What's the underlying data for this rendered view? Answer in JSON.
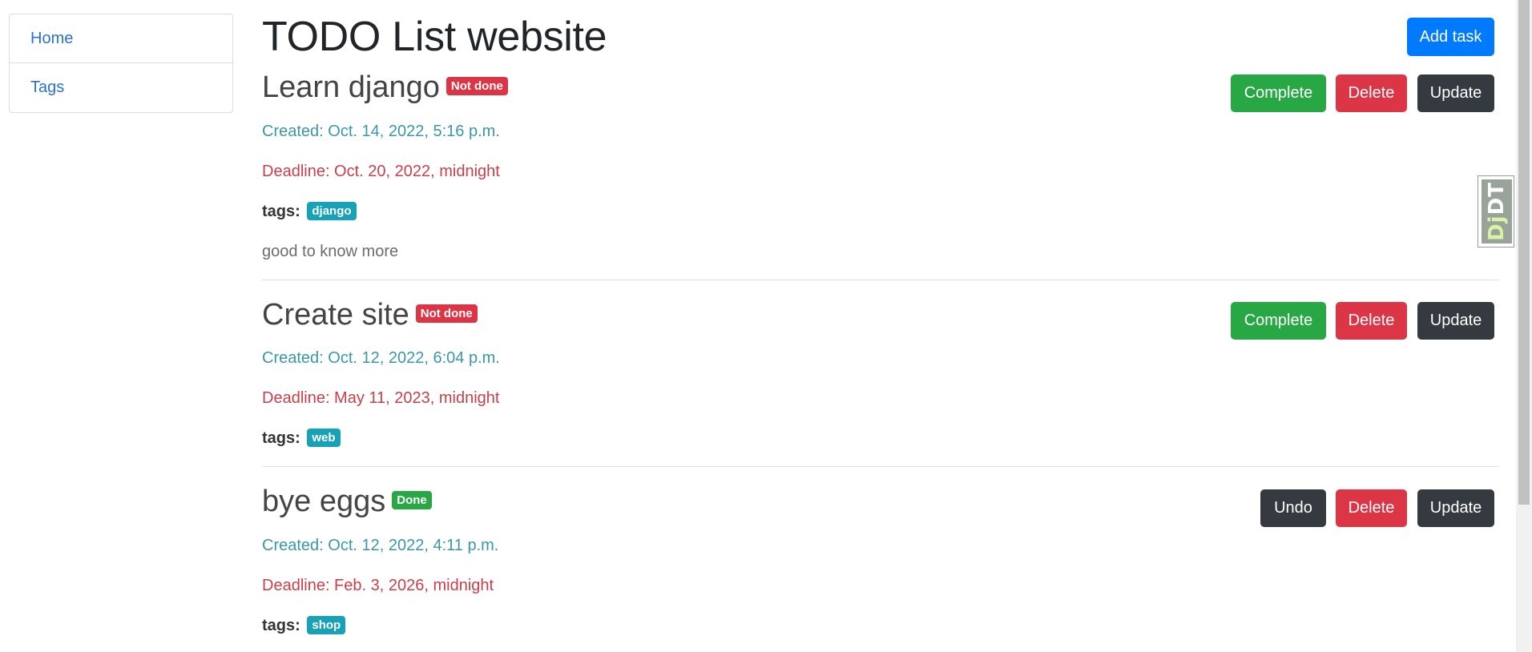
{
  "sidebar": {
    "items": [
      {
        "label": "Home"
      },
      {
        "label": "Tags"
      }
    ]
  },
  "header": {
    "title": "TODO List website",
    "add_task_label": "Add task"
  },
  "tasks": [
    {
      "title": "Learn django",
      "status": "Not done",
      "created": "Created: Oct. 14, 2022, 5:16 p.m.",
      "deadline": "Deadline: Oct. 20, 2022, midnight",
      "tags_label": "tags:",
      "tags": [
        "django"
      ],
      "description": "good to know more",
      "actions": {
        "toggle": "Complete",
        "delete": "Delete",
        "update": "Update"
      }
    },
    {
      "title": "Create site",
      "status": "Not done",
      "created": "Created: Oct. 12, 2022, 6:04 p.m.",
      "deadline": "Deadline: May 11, 2023, midnight",
      "tags_label": "tags:",
      "tags": [
        "web"
      ],
      "description": "",
      "actions": {
        "toggle": "Complete",
        "delete": "Delete",
        "update": "Update"
      }
    },
    {
      "title": "bye eggs",
      "status": "Done",
      "created": "Created: Oct. 12, 2022, 4:11 p.m.",
      "deadline": "Deadline: Feb. 3, 2026, midnight",
      "tags_label": "tags:",
      "tags": [
        "shop"
      ],
      "description": "",
      "actions": {
        "toggle": "Undo",
        "delete": "Delete",
        "update": "Update"
      }
    }
  ],
  "debug_toolbar": {
    "dj": "Dj",
    "dt": "DT"
  },
  "colors": {
    "primary": "#007bff",
    "success": "#28a745",
    "danger": "#dc3545",
    "dark": "#343a40",
    "info": "#17a2b8"
  }
}
